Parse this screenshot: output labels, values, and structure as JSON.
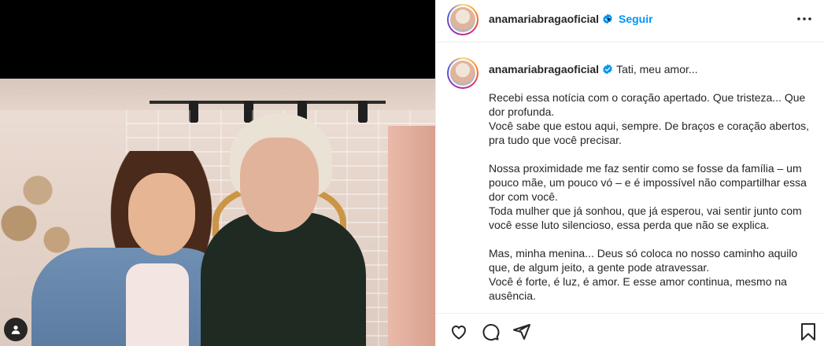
{
  "post": {
    "username": "anamariabragaoficial",
    "follow_label": "Seguir",
    "separator": "•",
    "caption_title": "Tati, meu amor...",
    "caption_lines": [
      "Recebi essa notícia com o coração apertado. Que tristeza... Que dor profunda.",
      "Você sabe que estou aqui, sempre. De braços e coração abertos, pra tudo que você precisar.",
      "",
      "Nossa proximidade me faz sentir como se fosse da família – um pouco mãe, um pouco vó – e é impossível não compartilhar essa dor com você.",
      "Toda mulher que já sonhou, que já esperou, vai sentir junto com você esse luto silencioso, essa perda que não se explica.",
      "",
      "Mas, minha menina... Deus só coloca no nosso caminho aquilo que, de algum jeito, a gente pode atravessar.",
      "Você é forte, é luz, é amor. E esse amor continua, mesmo na ausência."
    ]
  },
  "icons": {
    "verified": "verified-badge-icon",
    "more": "more-options-icon",
    "like": "heart-icon",
    "comment": "comment-icon",
    "share": "send-icon",
    "save": "bookmark-icon",
    "tag": "user-tag-icon"
  },
  "colors": {
    "link_blue": "#0095f6",
    "verified_blue": "#0095f6",
    "text": "#262626",
    "divider": "#efefef"
  }
}
